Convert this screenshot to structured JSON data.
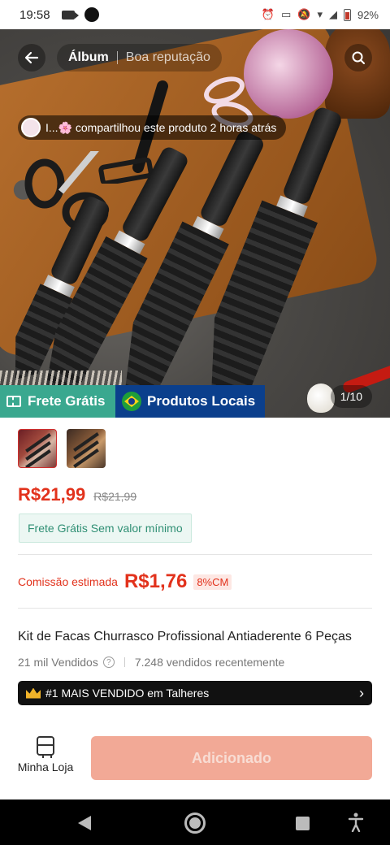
{
  "status_bar": {
    "time": "19:58",
    "battery": "92%"
  },
  "gallery": {
    "tabs": [
      {
        "label": "Álbum",
        "active": true
      },
      {
        "label": "Boa reputação",
        "active": false
      }
    ],
    "share_notice": "I...🌸 compartilhou este produto 2 horas atrás",
    "counter": "1/10",
    "badges": {
      "frete": "Frete Grátis",
      "local": "Produtos Locais"
    }
  },
  "product": {
    "price": "R$21,99",
    "original_price": "R$21,99",
    "frete_chip": "Frete Grátis Sem valor mínimo",
    "commission": {
      "label": "Comissão estimada",
      "value": "R$1,76",
      "rate": "8%CM"
    },
    "title": "Kit de Facas Churrasco Profissional Antiaderente 6 Peças",
    "sold_total": "21 mil Vendidos",
    "sold_recent": "7.248 vendidos recentemente",
    "rank": "#1 MAIS VENDIDO em Talheres"
  },
  "actions": {
    "store_label": "Minha Loja",
    "add_button": "Adicionado"
  },
  "colors": {
    "price_red": "#e2321c",
    "frete_green": "#3aa88f",
    "local_blue": "#0b3f8c",
    "added_button": "#f2a996"
  }
}
